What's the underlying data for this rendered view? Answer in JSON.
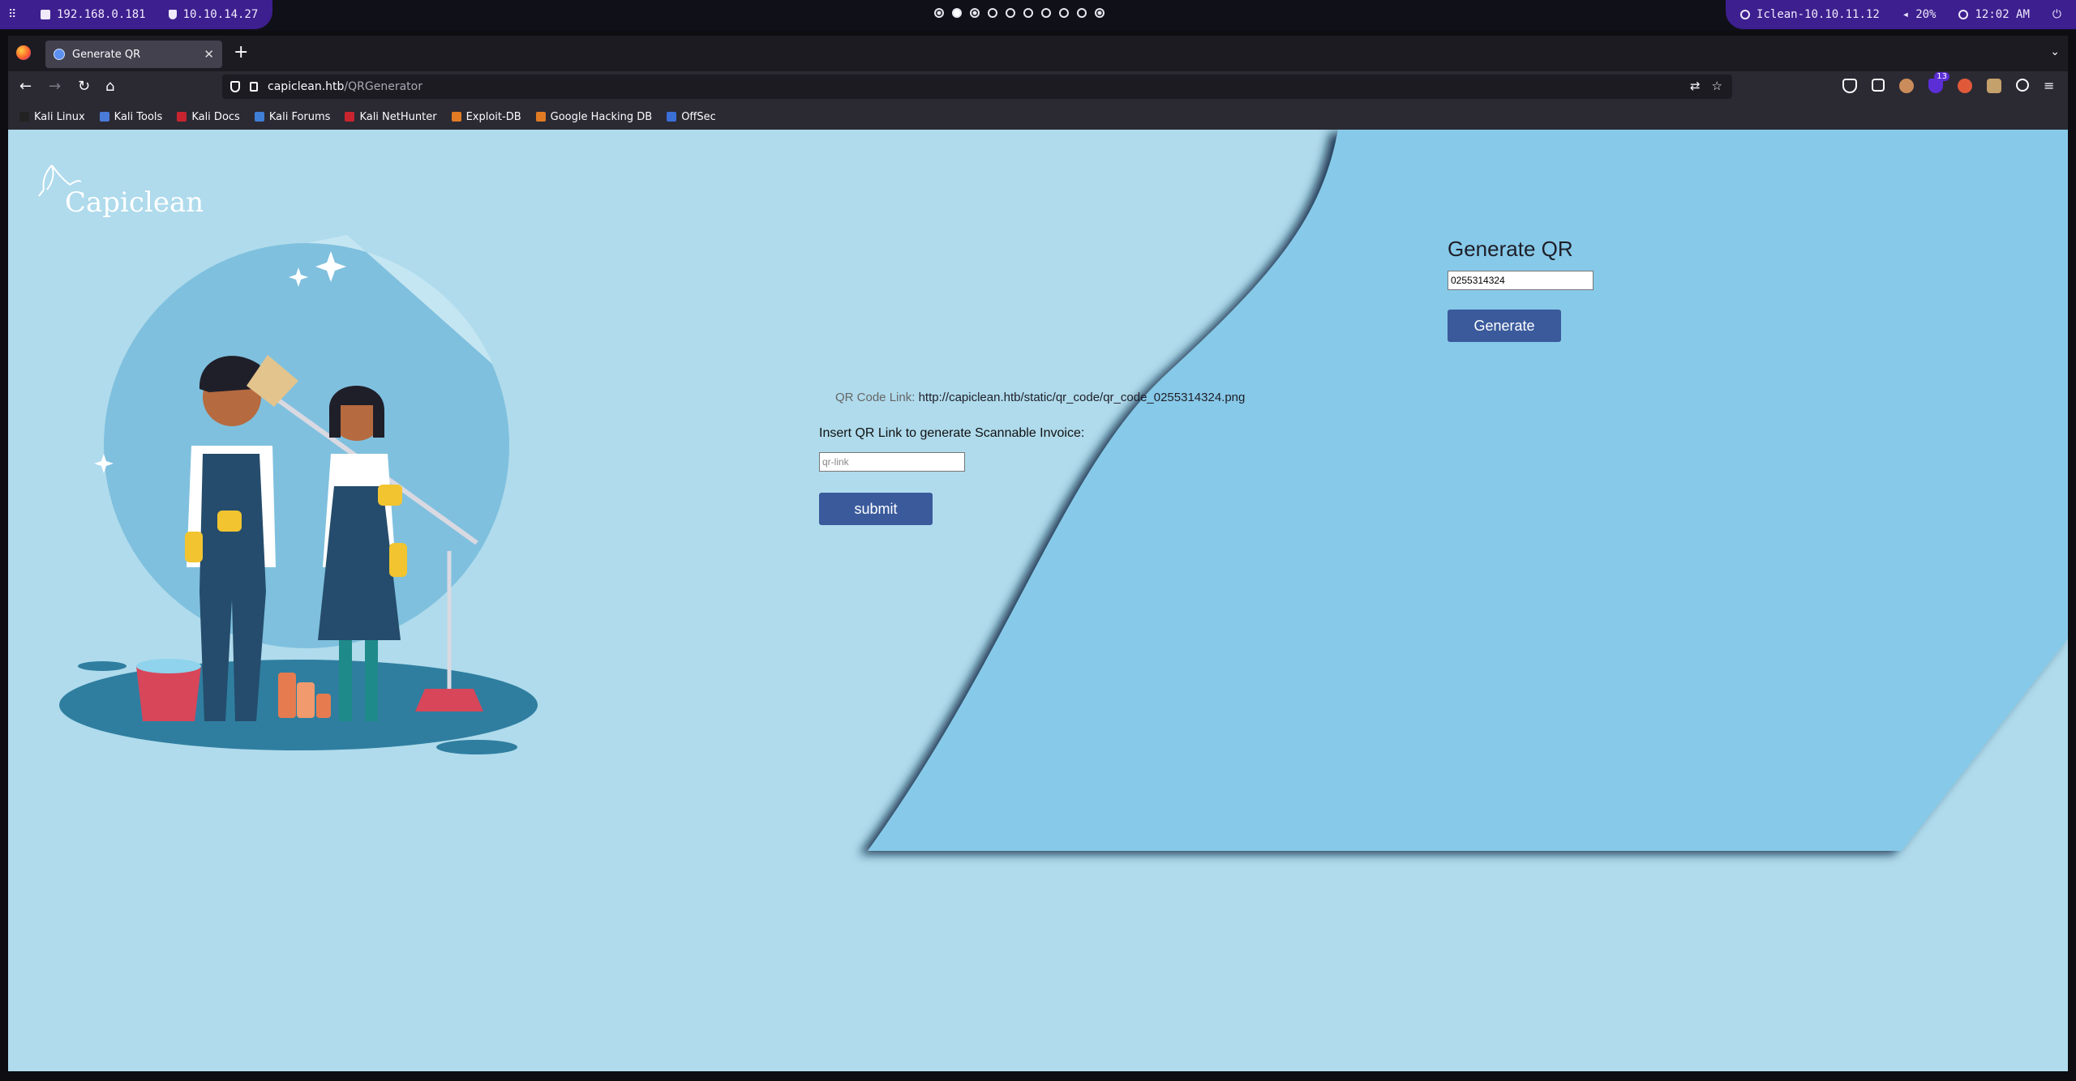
{
  "system_bar": {
    "left": [
      {
        "icon": "apps-grid-icon",
        "label": ""
      },
      {
        "icon": "monitor-icon",
        "label": "192.168.0.181"
      },
      {
        "icon": "vpn-shield-icon",
        "label": "10.10.14.27"
      }
    ],
    "workspaces": [
      "occupied",
      "active",
      "occupied",
      "empty",
      "empty",
      "empty",
      "empty",
      "empty",
      "empty",
      "occupied"
    ],
    "right": [
      {
        "icon": "target-icon",
        "label": "Iclean-10.10.11.12"
      },
      {
        "icon": "volume-icon",
        "label": "20%"
      },
      {
        "icon": "clock-icon",
        "label": "12:02 AM"
      },
      {
        "icon": "power-icon",
        "label": ""
      }
    ]
  },
  "browser": {
    "tab_title": "Generate QR",
    "url_host": "capiclean.htb",
    "url_path": "/QRGenerator",
    "bookmarks": [
      {
        "label": "Kali Linux",
        "color": "#222222"
      },
      {
        "label": "Kali Tools",
        "color": "#4a7bd8"
      },
      {
        "label": "Kali Docs",
        "color": "#c8242f"
      },
      {
        "label": "Kali Forums",
        "color": "#3f7fd6"
      },
      {
        "label": "Kali NetHunter",
        "color": "#c8242f"
      },
      {
        "label": "Exploit-DB",
        "color": "#e07b24"
      },
      {
        "label": "Google Hacking DB",
        "color": "#e07b24"
      },
      {
        "label": "OffSec",
        "color": "#3b6fd8"
      }
    ],
    "extension_badge": "13"
  },
  "page": {
    "brand": "Capiclean",
    "generate_title": "Generate QR",
    "invoice_id_value": "0255314324",
    "generate_button": "Generate",
    "qr_link_label": "QR Code Link:",
    "qr_link_value": "http://capiclean.htb/static/qr_code/qr_code_0255314324.png",
    "insert_label": "Insert QR Link to generate Scannable Invoice:",
    "qr_link_placeholder": "qr-link",
    "submit_button": "submit"
  },
  "colors": {
    "page_bg": "#afdbec",
    "panel_bg": "#87c9e8",
    "button": "#3a5a9c",
    "purple_pill": "#3d1f8f"
  }
}
